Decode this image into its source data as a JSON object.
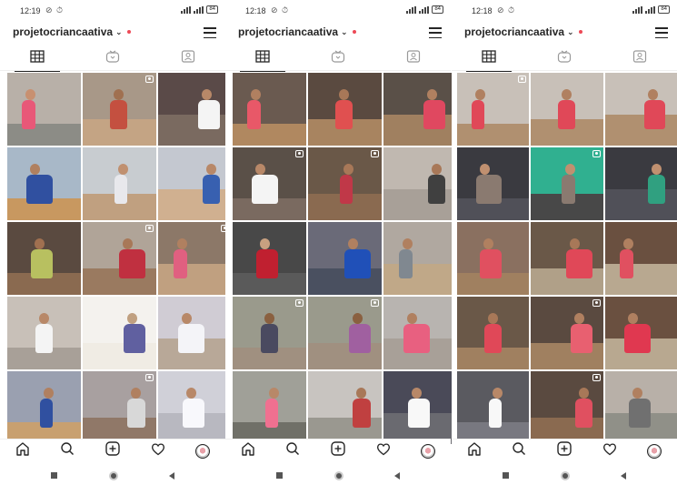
{
  "phones": [
    {
      "status": {
        "time": "12:19",
        "status_icons": "⊘ ⏱",
        "battery": "84"
      },
      "username": "projetocriancaativa",
      "cells": [
        {
          "bg": "#b8b0a8",
          "floor": "#8c8c86",
          "fig": "#e85878",
          "skin": "#c89070",
          "video": false
        },
        {
          "bg": "#a89888",
          "floor": "#c4a484",
          "fig": "#c45040",
          "skin": "#a07050",
          "video": true
        },
        {
          "bg": "#5a4a48",
          "floor": "#7a6a60",
          "fig": "#f4f4f4",
          "skin": "#b88868",
          "video": false
        },
        {
          "bg": "#a8b8c8",
          "floor": "#c89860",
          "fig": "#3050a0",
          "skin": "#b08060",
          "video": false
        },
        {
          "bg": "#c8ccd0",
          "floor": "#c0a080",
          "fig": "#e8e8ec",
          "skin": "#c09070",
          "video": false
        },
        {
          "bg": "#c4c8d0",
          "floor": "#d0b090",
          "fig": "#3860b0",
          "skin": "#b88868",
          "video": false
        },
        {
          "bg": "#5a4a40",
          "floor": "#8a6a50",
          "fig": "#b8c060",
          "skin": "#a07050",
          "video": false
        },
        {
          "bg": "#b0a498",
          "floor": "#9a7a60",
          "fig": "#c03040",
          "skin": "#a87858",
          "video": true
        },
        {
          "bg": "#8c7868",
          "floor": "#c0a080",
          "fig": "#e06080",
          "skin": "#b08060",
          "video": true
        },
        {
          "bg": "#c8c0b8",
          "floor": "#a8a098",
          "fig": "#f4f4f4",
          "skin": "#b88868",
          "video": false
        },
        {
          "bg": "#f4f2ee",
          "floor": "#f0ece4",
          "fig": "#6060a0",
          "skin": "#c0a080",
          "video": false
        },
        {
          "bg": "#d0ccd4",
          "floor": "#b8a898",
          "fig": "#f4f4f8",
          "skin": "#b88868",
          "video": false
        },
        {
          "bg": "#9aa0b0",
          "floor": "#c8a070",
          "fig": "#3050a0",
          "skin": "#b08060",
          "video": false
        },
        {
          "bg": "#a8a0a0",
          "floor": "#907868",
          "fig": "#d8d8d8",
          "skin": "#b08060",
          "video": true
        },
        {
          "bg": "#d0d0d8",
          "floor": "#b8b8c0",
          "fig": "#f8f8fc",
          "skin": "#b88868",
          "video": false
        }
      ]
    },
    {
      "status": {
        "time": "12:18",
        "status_icons": "⊘ ⏱",
        "battery": "84"
      },
      "username": "projetocriancaativa",
      "cells": [
        {
          "bg": "#6a5a50",
          "floor": "#b08860",
          "fig": "#e85868",
          "skin": "#b08060",
          "video": false
        },
        {
          "bg": "#5a4a40",
          "floor": "#a88460",
          "fig": "#e05050",
          "skin": "#a87858",
          "video": false
        },
        {
          "bg": "#5a5048",
          "floor": "#a08060",
          "fig": "#e04860",
          "skin": "#b08060",
          "video": false
        },
        {
          "bg": "#5a5048",
          "floor": "#7a6a60",
          "fig": "#f4f4f4",
          "skin": "#b88868",
          "video": true
        },
        {
          "bg": "#6a5848",
          "floor": "#8a6a50",
          "fig": "#c03848",
          "skin": "#a87858",
          "video": true
        },
        {
          "bg": "#c0b8b0",
          "floor": "#a8a098",
          "fig": "#404040",
          "skin": "#a87858",
          "video": false
        },
        {
          "bg": "#484848",
          "floor": "#5a5a5a",
          "fig": "#c02030",
          "skin": "#c8a080",
          "video": false
        },
        {
          "bg": "#6a6a78",
          "floor": "#4a5060",
          "fig": "#2050b8",
          "skin": "#b08060",
          "video": false
        },
        {
          "bg": "#b0a8a0",
          "floor": "#c0a888",
          "fig": "#808890",
          "skin": "#b08060",
          "video": false
        },
        {
          "bg": "#9a9a8c",
          "floor": "#a09080",
          "fig": "#4a4a60",
          "skin": "#8a6040",
          "video": true
        },
        {
          "bg": "#9a9a8c",
          "floor": "#a09080",
          "fig": "#a060a0",
          "skin": "#8a6040",
          "video": true
        },
        {
          "bg": "#b8b4b0",
          "floor": "#a8a098",
          "fig": "#e86080",
          "skin": "#b08060",
          "video": false
        },
        {
          "bg": "#a0a098",
          "floor": "#707068",
          "fig": "#f07090",
          "skin": "#b88868",
          "video": false
        },
        {
          "bg": "#c8c4c0",
          "floor": "#9a9890",
          "fig": "#c04040",
          "skin": "#a87858",
          "video": false
        },
        {
          "bg": "#4a4a58",
          "floor": "#6a6a70",
          "fig": "#f8f8f8",
          "skin": "#b88868",
          "video": false
        }
      ]
    },
    {
      "status": {
        "time": "12:18",
        "status_icons": "⊘ ⏱",
        "battery": "84"
      },
      "username": "projetocriancaativa",
      "cells": [
        {
          "bg": "#c8c0b8",
          "floor": "#b09070",
          "fig": "#e04858",
          "skin": "#b08060",
          "video": true
        },
        {
          "bg": "#c8c0b8",
          "floor": "#b09070",
          "fig": "#e04858",
          "skin": "#b08060",
          "video": false
        },
        {
          "bg": "#c8c0b8",
          "floor": "#b09070",
          "fig": "#e04858",
          "skin": "#b08060",
          "video": false
        },
        {
          "bg": "#3a3a40",
          "floor": "#505058",
          "fig": "#8a7a70",
          "skin": "#c09070",
          "video": false
        },
        {
          "bg": "#30b090",
          "floor": "#484848",
          "fig": "#8a7a70",
          "skin": "#c09070",
          "video": true
        },
        {
          "bg": "#3a3a40",
          "floor": "#505058",
          "fig": "#30a080",
          "skin": "#c09070",
          "video": false
        },
        {
          "bg": "#8a7060",
          "floor": "#a08060",
          "fig": "#e05060",
          "skin": "#b08060",
          "video": false
        },
        {
          "bg": "#6a5848",
          "floor": "#b0a088",
          "fig": "#e04858",
          "skin": "#a87858",
          "video": false
        },
        {
          "bg": "#6a5040",
          "floor": "#b8a890",
          "fig": "#e05060",
          "skin": "#b08060",
          "video": false
        },
        {
          "bg": "#6a5848",
          "floor": "#a08060",
          "fig": "#e04858",
          "skin": "#a87858",
          "video": false
        },
        {
          "bg": "#5a4a40",
          "floor": "#a08060",
          "fig": "#e86070",
          "skin": "#b08060",
          "video": true
        },
        {
          "bg": "#6a5040",
          "floor": "#b8a890",
          "fig": "#e03850",
          "skin": "#b08060",
          "video": false
        },
        {
          "bg": "#5a5a60",
          "floor": "#787880",
          "fig": "#f8f8f8",
          "skin": "#b88868",
          "video": false
        },
        {
          "bg": "#5a4a40",
          "floor": "#8a6a50",
          "fig": "#e05060",
          "skin": "#a87858",
          "video": true
        },
        {
          "bg": "#b8b0a8",
          "floor": "#909088",
          "fig": "#707070",
          "skin": "#b08060",
          "video": false
        }
      ]
    }
  ]
}
